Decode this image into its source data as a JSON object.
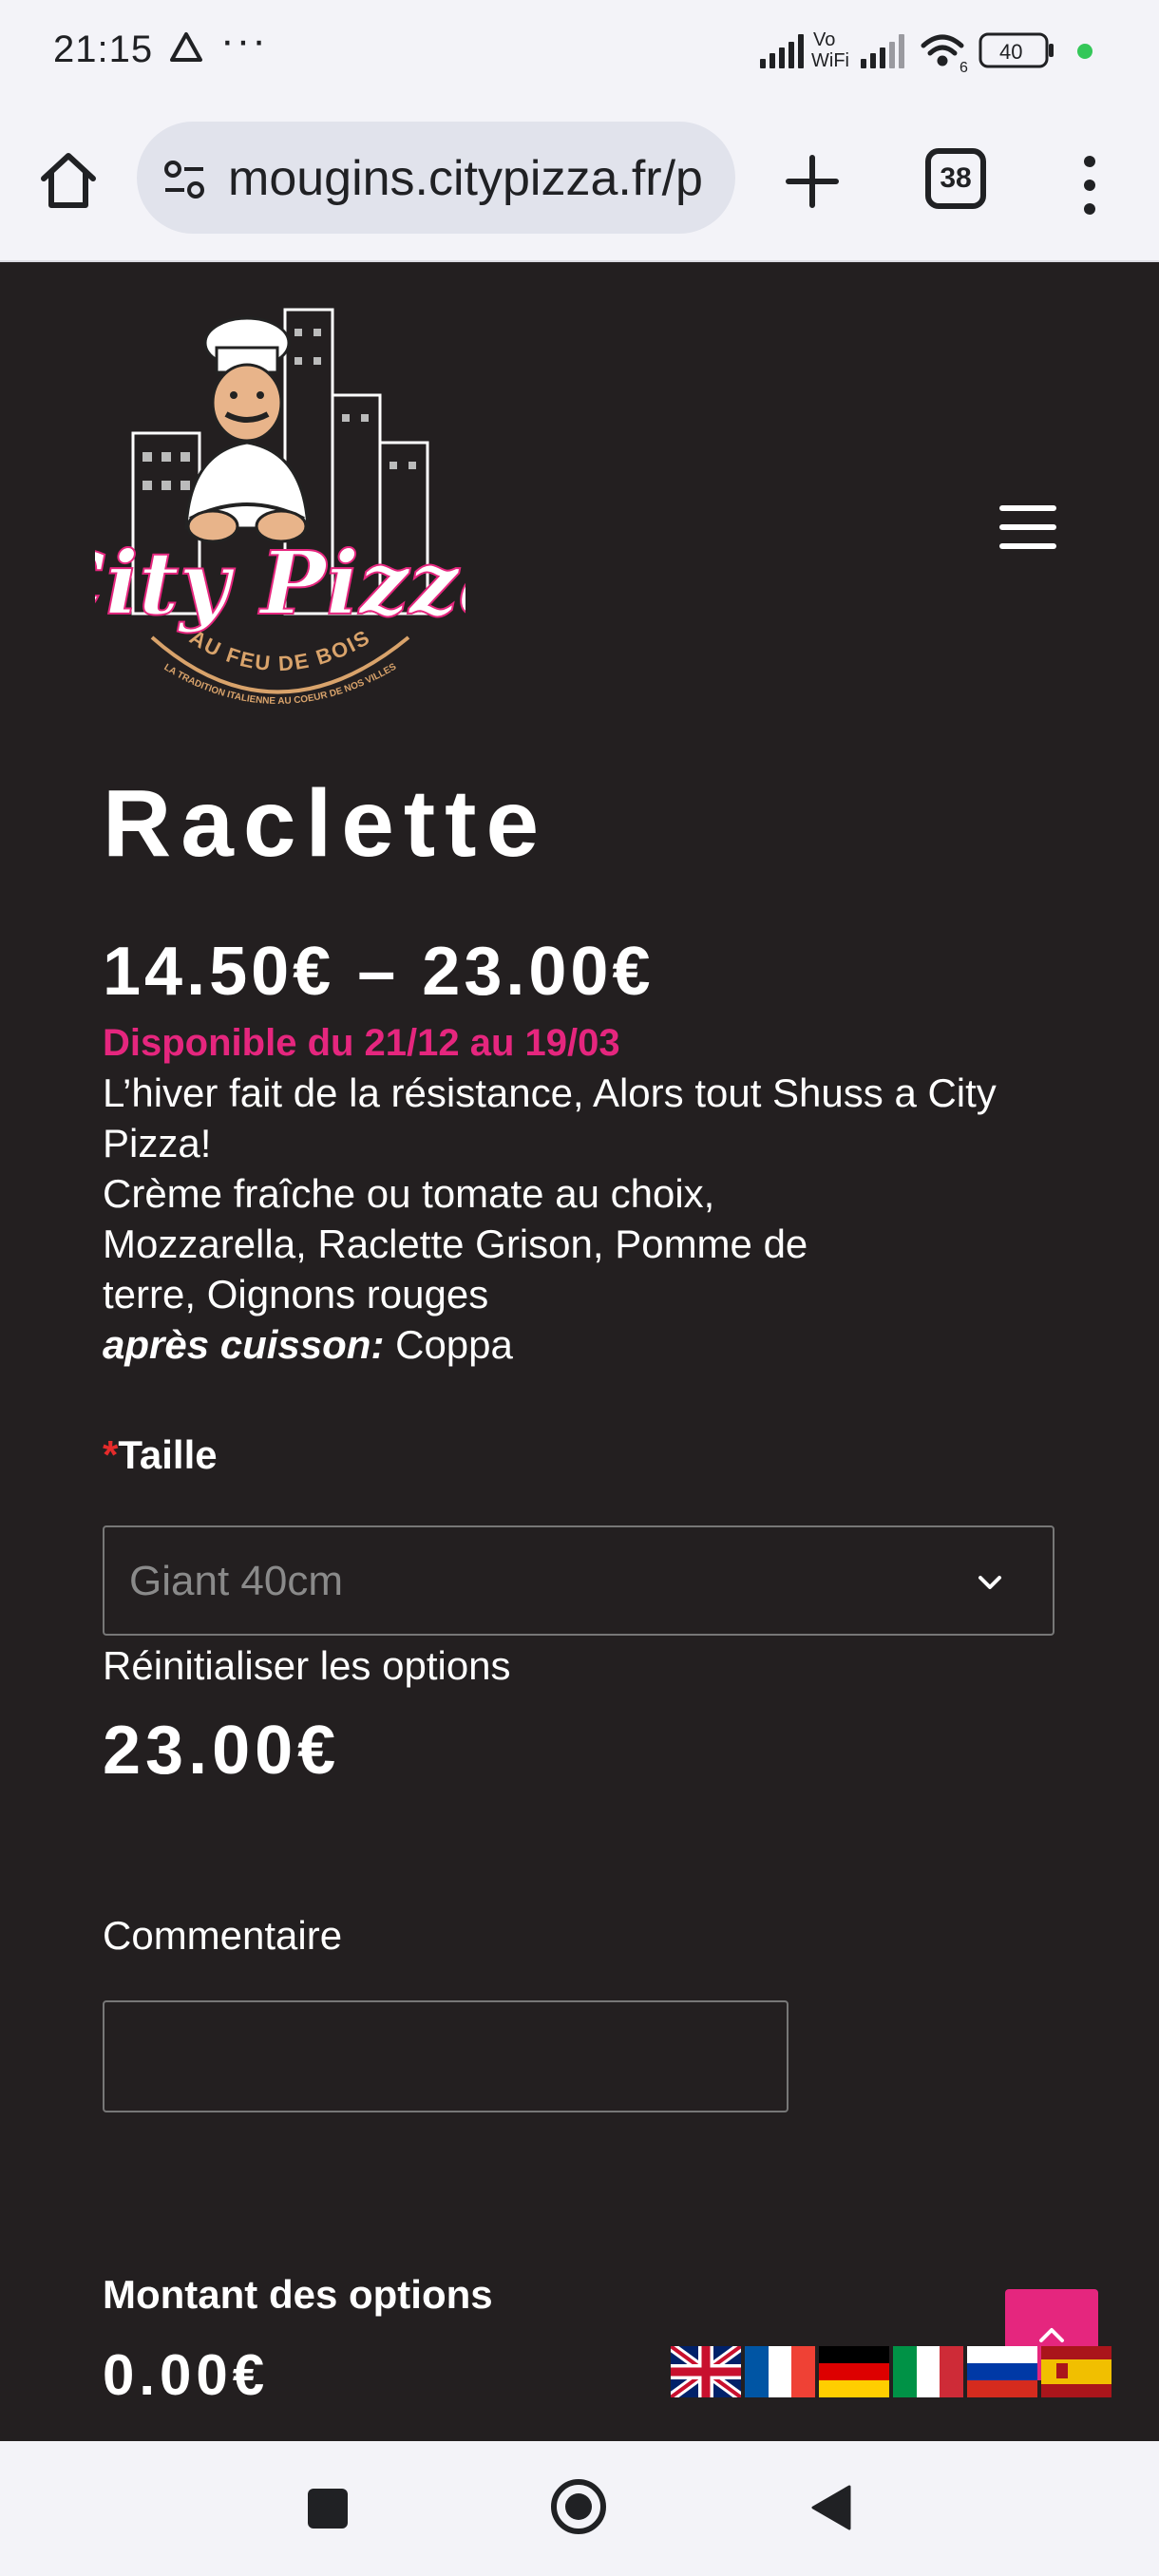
{
  "status_bar": {
    "time": "21:15",
    "dots": "···",
    "wifi_label": "Vo\nWiFi",
    "battery": "40",
    "wifi_badge": "6"
  },
  "browser": {
    "url": "mougins.citypizza.fr/p",
    "tab_count": "38"
  },
  "logo": {
    "text": "City Pizza",
    "subtitle": "AU FEU DE BOIS",
    "tagline": "LA TRADITION ITALIENNE AU COEUR DE NOS VILLES"
  },
  "product": {
    "title": "Raclette",
    "price_range": "14.50€ – 23.00€",
    "availability": "Disponible du 21/12 au 19/03",
    "description_line1": "L’hiver fait de la résistance, Alors tout Shuss a City Pizza!",
    "description_line2": "Crème fraîche ou tomate au choix,",
    "description_line3": "Mozzarella, Raclette Grison, Pomme de terre, Oignons rouges",
    "after_cooking_label": "après cuisson:",
    "after_cooking_value": " Coppa"
  },
  "options": {
    "required_mark": "*",
    "size_label": "Taille",
    "size_selected": "Giant 40cm",
    "reset_label": "Réinitialiser les options",
    "total_price": "23.00€",
    "comment_label": "Commentaire",
    "options_amount_label": "Montant des options",
    "options_amount": "0.00€"
  },
  "languages": [
    "English",
    "Français",
    "Deutsch",
    "Italiano",
    "Русский",
    "Español"
  ],
  "colors": {
    "page_bg": "#231f20",
    "accent_pink": "#e5267e",
    "required_red": "#e52b2b",
    "chrome_bg": "#f3f3f8"
  }
}
